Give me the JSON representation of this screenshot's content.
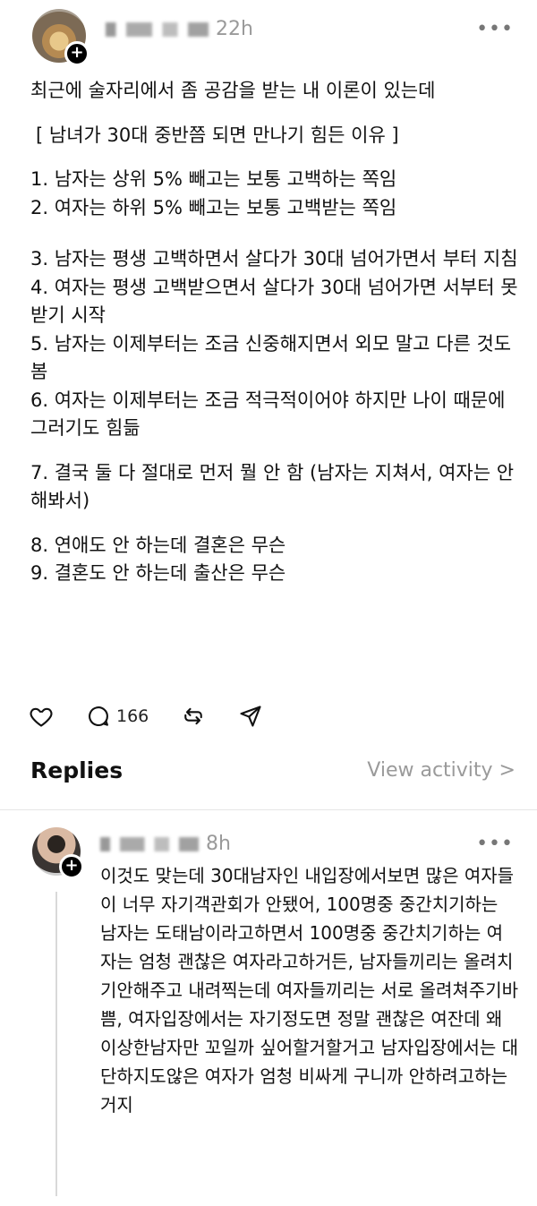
{
  "post": {
    "time": "22h",
    "more_label": "•••",
    "lines": [
      "최근에 술자리에서 좀 공감을 받는 내 이론이 있는데",
      "[ 남녀가 30대 중반쯤 되면 만나기 힘든 이유 ]",
      "1. 남자는 상위 5% 빼고는 보통 고백하는 쪽임",
      "2. 여자는 하위 5% 빼고는 보통 고백받는 쪽임",
      "3. 남자는 평생 고백하면서 살다가 30대 넘어가면서 부터 지침",
      "4. 여자는 평생 고백받으면서 살다가 30대 넘어가면 서부터 못 받기 시작",
      "5. 남자는 이제부터는 조금 신중해지면서 외모 말고 다른 것도 봄",
      "6. 여자는 이제부터는 조금 적극적이어야 하지만 나이 때문에 그러기도 힘듦",
      "7. 결국 둘 다 절대로 먼저 뭘 안 함 (남자는 지쳐서, 여자는 안 해봐서)",
      "8. 연애도 안 하는데 결혼은 무슨",
      "9. 결혼도 안 하는데 출산은 무슨"
    ],
    "reply_count": "166"
  },
  "icons": {
    "like": "heart-icon",
    "reply": "comment-icon",
    "repost": "repost-icon",
    "share": "send-icon"
  },
  "replies_header": {
    "title": "Replies",
    "view_activity": "View activity >"
  },
  "reply": {
    "time": "8h",
    "more_label": "•••",
    "text": "이것도 맞는데 30대남자인 내입장에서보면 많은 여자들이 너무 자기객관회가 안됐어, 100명중 중간치기하는 남자는 도태남이라고하면서 100명중 중간치기하는 여자는 엄청 괜찮은 여자라고하거든, 남자들끼리는 올려치기안해주고 내려찍는데 여자들끼리는 서로 올려쳐주기바쁨, 여자입장에서는 자기정도면 정말 괜찮은 여잔데 왜 이상한남자만 꼬일까 싶어할거할거고 남자입장에서는 대단하지도않은 여자가 엄청 비싸게 구니까 안하려고하는거지"
  }
}
